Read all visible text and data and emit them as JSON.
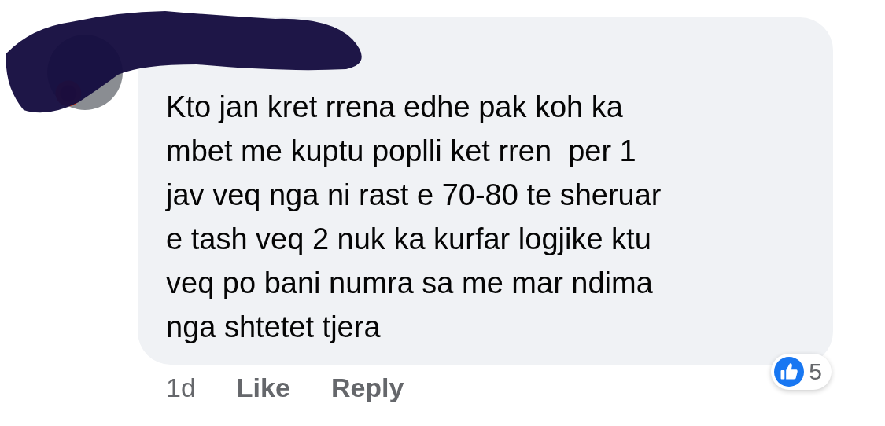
{
  "comment": {
    "text": "Kto jan kret rrena edhe pak koh ka\nmbet me kuptu poplli ket rren  per 1\njav veq nga ni rast e 70-80 te sheruar\ne tash veq 2 nuk ka kurfar logjike ktu\nveq po bani numra sa me mar ndima\nnga shtetet tjera",
    "time": "1d",
    "actions": [
      "Like",
      "Reply"
    ],
    "reaction_count": "5"
  }
}
